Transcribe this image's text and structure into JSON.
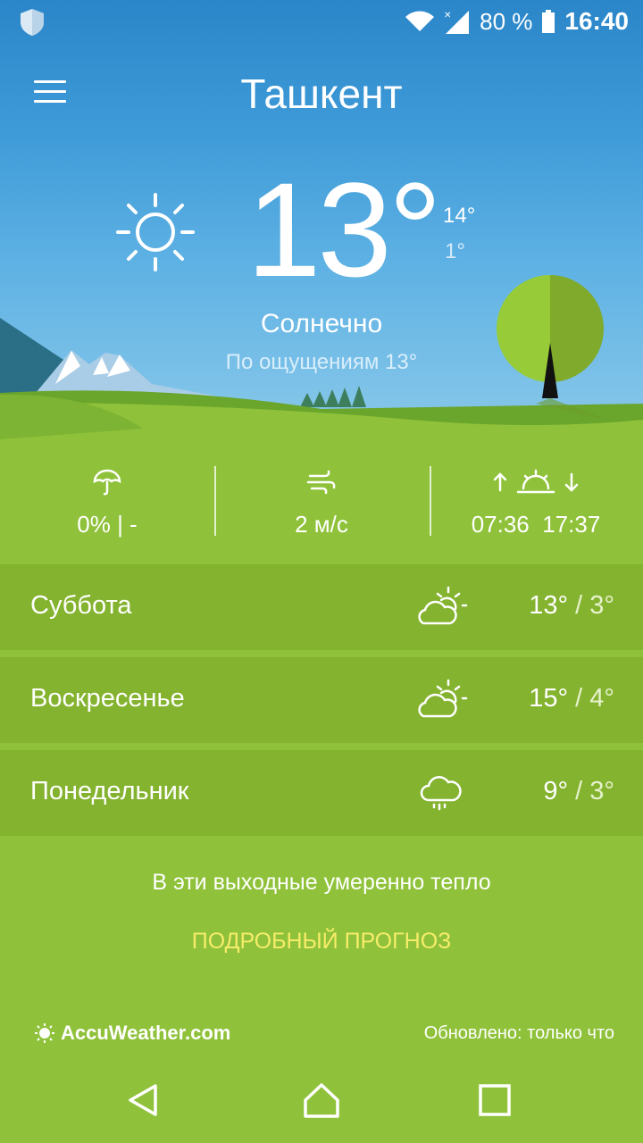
{
  "status": {
    "battery": "80 %",
    "time": "16:40"
  },
  "header": {
    "city": "Ташкент"
  },
  "current": {
    "temp": "13°",
    "high": "14°",
    "low": "1°",
    "condition": "Солнечно",
    "feels_like": "По ощущениям 13°"
  },
  "stats": {
    "precip": "0% | -",
    "wind": "2 м/с",
    "sunrise": "07:36",
    "sunset": "17:37"
  },
  "forecast": [
    {
      "day": "Суббота",
      "icon": "partly-cloudy-icon",
      "high": "13°",
      "low": "3°"
    },
    {
      "day": "Воскресенье",
      "icon": "partly-cloudy-icon",
      "high": "15°",
      "low": "4°"
    },
    {
      "day": "Понедельник",
      "icon": "rain-cloud-icon",
      "high": "9°",
      "low": "3°"
    }
  ],
  "summary": "В эти выходные умеренно тепло",
  "detail_link": "ПОДРОБНЫЙ ПРОГНОЗ",
  "footer": {
    "brand": "AccuWeather.com",
    "updated": "Обновлено: только что"
  },
  "colors": {
    "grass": "#8fc23a",
    "row": "#84b32f",
    "link": "#f6ec6a",
    "sky": "#3f9bd8"
  }
}
